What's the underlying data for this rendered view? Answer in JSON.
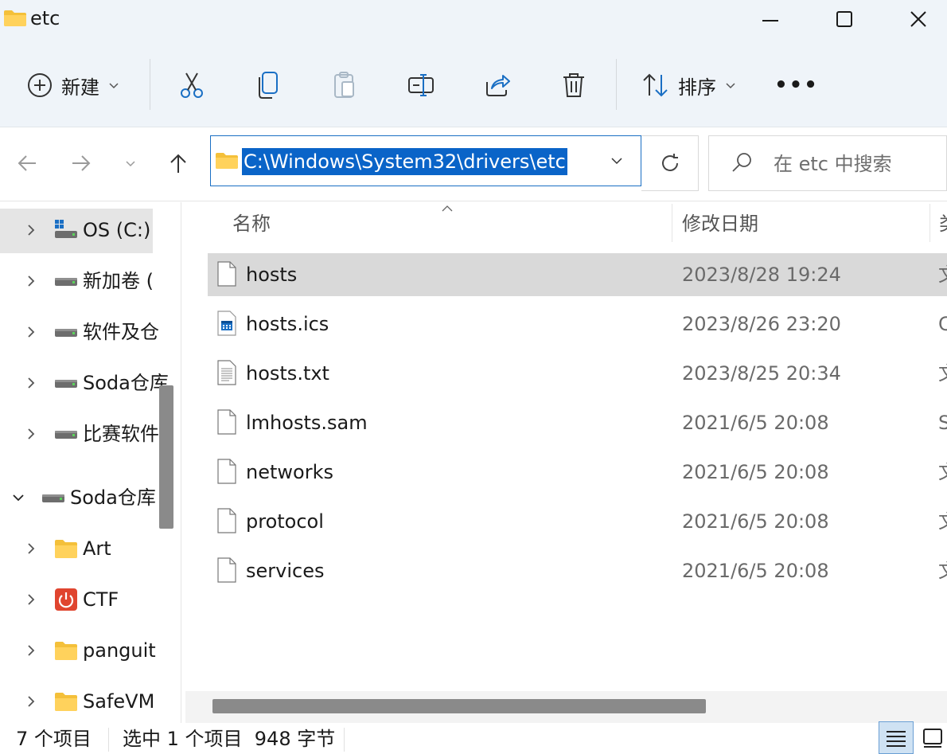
{
  "window": {
    "title": "etc"
  },
  "commandbar": {
    "new_label": "新建",
    "sort_label": "排序",
    "more_label": "•••"
  },
  "address": {
    "path": "C:\\Windows\\System32\\drivers\\etc"
  },
  "search": {
    "placeholder": "在 etc 中搜索"
  },
  "sidebar": {
    "items": [
      {
        "label": "OS (C:)"
      },
      {
        "label": "新加卷 ("
      },
      {
        "label": "软件及仓"
      },
      {
        "label": "Soda仓库"
      },
      {
        "label": "比赛软件"
      },
      {
        "label": "Soda仓库"
      },
      {
        "label": "Art"
      },
      {
        "label": "CTF"
      },
      {
        "label": "panguit"
      },
      {
        "label": "SafeVM"
      }
    ]
  },
  "filelist": {
    "columns": [
      "名称",
      "修改日期",
      "类"
    ],
    "rows": [
      {
        "name": "hosts",
        "date": "2023/8/28 19:24",
        "type": "文"
      },
      {
        "name": "hosts.ics",
        "date": "2023/8/26 23:20",
        "type": "C"
      },
      {
        "name": "hosts.txt",
        "date": "2023/8/25 20:34",
        "type": "文"
      },
      {
        "name": "lmhosts.sam",
        "date": "2021/6/5 20:08",
        "type": "S"
      },
      {
        "name": "networks",
        "date": "2021/6/5 20:08",
        "type": "文"
      },
      {
        "name": "protocol",
        "date": "2021/6/5 20:08",
        "type": "文"
      },
      {
        "name": "services",
        "date": "2021/6/5 20:08",
        "type": "文"
      }
    ]
  },
  "status": {
    "count": "7 个项目",
    "selection": "选中 1 个项目  948 字节"
  },
  "colors": {
    "accent": "#0a64c8",
    "chrome_bg": "#eff4f9",
    "selected_row": "#d9d9d9"
  }
}
